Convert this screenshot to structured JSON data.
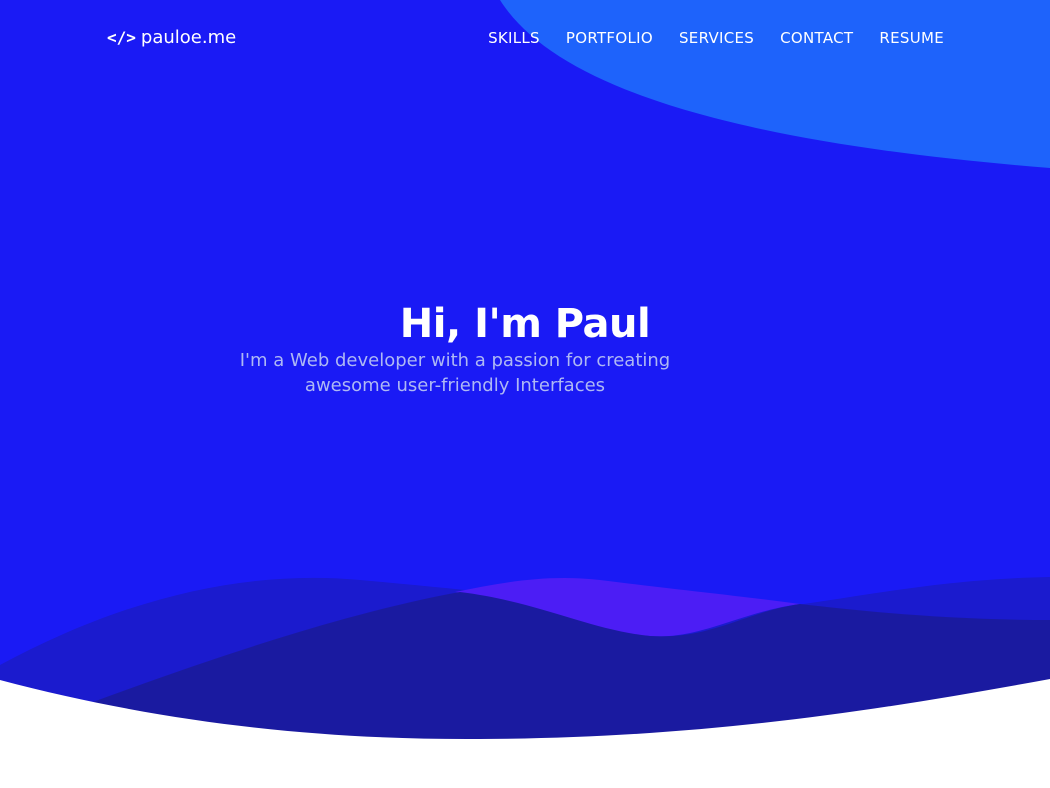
{
  "colors": {
    "hero_background": "#1a1af5",
    "top_blob": "#1e63fb",
    "wave_back": "#1b1bce",
    "wave_accent": "#4c1df5",
    "wave_front": "#1a1aa0",
    "subtitle_text": "#aeb8f4"
  },
  "header": {
    "logo_icon": "code-icon",
    "logo_glyph": "</>",
    "logo_text": "pauloe.me",
    "nav": [
      {
        "label": "SKILLS"
      },
      {
        "label": "PORTFOLIO"
      },
      {
        "label": "SERVICES"
      },
      {
        "label": "CONTACT"
      },
      {
        "label": "RESUME"
      }
    ]
  },
  "intro": {
    "title": "Hi, I'm Paul",
    "subtitle_line1": "I'm a Web developer with a passion for creating",
    "subtitle_line2": "awesome user-friendly Interfaces"
  }
}
